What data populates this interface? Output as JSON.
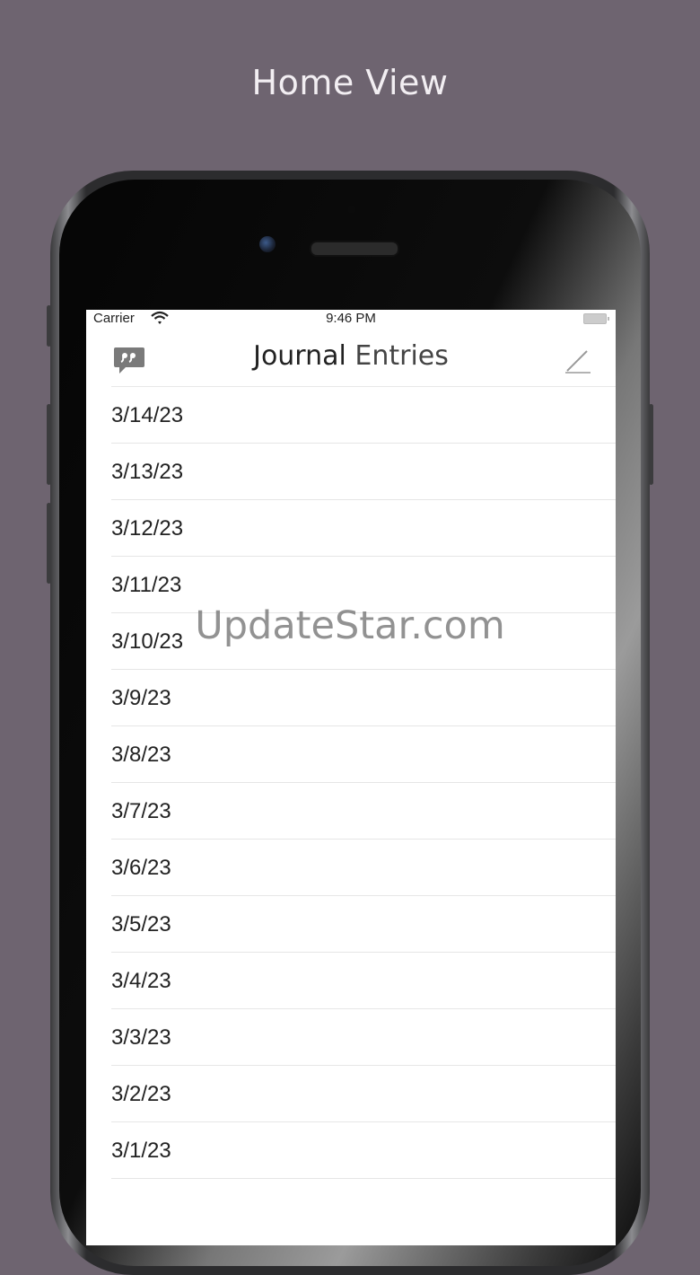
{
  "caption": "Home View",
  "status_bar": {
    "carrier": "Carrier",
    "time": "9:46 PM"
  },
  "nav": {
    "title_word1": "Journal",
    "title_word2": "Entries",
    "left_icon": "quote-bubble-icon",
    "right_icon": "compose-icon"
  },
  "entries": [
    "3/14/23",
    "3/13/23",
    "3/12/23",
    "3/11/23",
    "3/10/23",
    "3/9/23",
    "3/8/23",
    "3/7/23",
    "3/6/23",
    "3/5/23",
    "3/4/23",
    "3/3/23",
    "3/2/23",
    "3/1/23"
  ],
  "watermark": "UpdateStar.com",
  "colors": {
    "background": "#6e6470",
    "icon_gray": "#7a7a7a"
  }
}
